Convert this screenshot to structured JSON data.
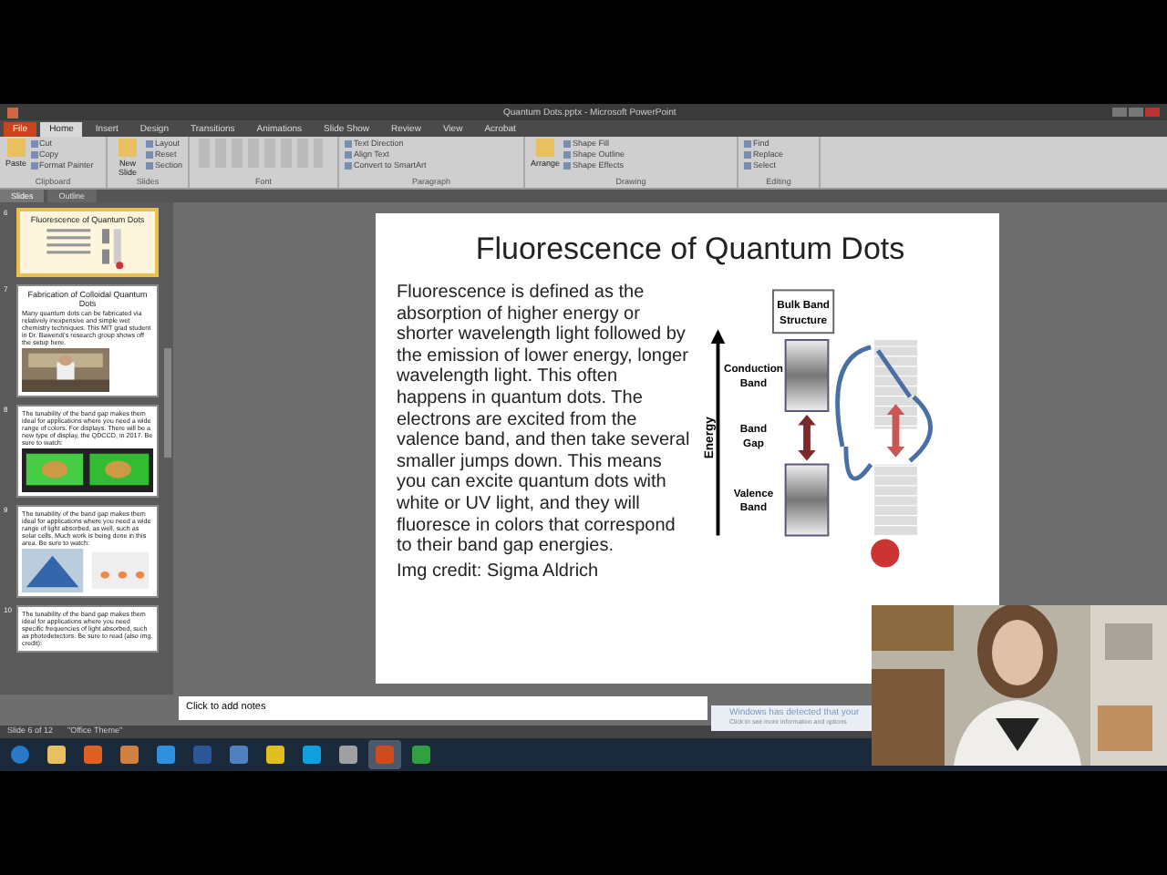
{
  "window": {
    "title": "Quantum Dots.pptx - Microsoft PowerPoint"
  },
  "ribbon_tabs": [
    {
      "label": "File",
      "selected": false,
      "kind": "file"
    },
    {
      "label": "Home",
      "selected": true,
      "kind": "tab"
    },
    {
      "label": "Insert",
      "selected": false,
      "kind": "tab"
    },
    {
      "label": "Design",
      "selected": false,
      "kind": "tab"
    },
    {
      "label": "Transitions",
      "selected": false,
      "kind": "tab"
    },
    {
      "label": "Animations",
      "selected": false,
      "kind": "tab"
    },
    {
      "label": "Slide Show",
      "selected": false,
      "kind": "tab"
    },
    {
      "label": "Review",
      "selected": false,
      "kind": "tab"
    },
    {
      "label": "View",
      "selected": false,
      "kind": "tab"
    },
    {
      "label": "Acrobat",
      "selected": false,
      "kind": "tab"
    }
  ],
  "ribbon_groups": [
    {
      "name": "Clipboard",
      "big": "Paste",
      "small": [
        "Cut",
        "Copy",
        "Format Painter"
      ]
    },
    {
      "name": "Slides",
      "big": "New Slide",
      "small": [
        "Layout",
        "Reset",
        "Section"
      ]
    },
    {
      "name": "Font"
    },
    {
      "name": "Paragraph",
      "small": [
        "Text Direction",
        "Align Text",
        "Convert to SmartArt"
      ]
    },
    {
      "name": "Drawing",
      "big": "Arrange",
      "small": [
        "Shape Fill",
        "Shape Outline",
        "Shape Effects"
      ]
    },
    {
      "name": "Editing",
      "small": [
        "Find",
        "Replace",
        "Select"
      ]
    }
  ],
  "panel_tabs": [
    {
      "label": "Slides",
      "selected": true
    },
    {
      "label": "Outline",
      "selected": false
    }
  ],
  "thumbnails": [
    {
      "number": "6",
      "selected": true,
      "title": "Fluorescence of Quantum Dots",
      "kind": "current"
    },
    {
      "number": "7",
      "selected": false,
      "title": "Fabrication of Colloidal Quantum Dots",
      "text": "Many quantum dots can be fabricated via relatively inexpensive and simple wet chemistry techniques. This MIT grad student in Dr. Bawendi's research group shows off the setup here."
    },
    {
      "number": "8",
      "selected": false,
      "text": "The tunability of the band gap makes them ideal for applications where you need a wide range of colors. For displays. There will be a new type of display, the QDCCD, in 2017. Be sure to watch:",
      "kind": "screens"
    },
    {
      "number": "9",
      "selected": false,
      "text": "The tunability of the band gap makes them ideal for applications where you need a wide range of light absorbed, as well, such as solar cells. Much work is being done in this area. Be sure to watch:",
      "kind": "diagram"
    },
    {
      "number": "10",
      "selected": false,
      "text": "The tunability of the band gap makes them ideal for applications where you need specific frequencies of light absorbed, such as photodetectors. Be sure to read (also img. credit):",
      "kind": "text"
    }
  ],
  "slide": {
    "title": "Fluorescence of Quantum Dots",
    "body": "Fluorescence is defined as the absorption of higher energy or shorter wavelength light followed by the emission of lower energy, longer wavelength light. This often happens in quantum dots. The electrons are excited from the valence band, and then take several smaller jumps down. This means you can excite quantum dots with white or UV light, and they will fluoresce in colors that correspond to their band gap energies.",
    "credit": "Img credit: Sigma Aldrich",
    "diagram": {
      "header": "Bulk Band Structure",
      "axis": "Energy",
      "conduction": "Conduction Band",
      "gap": "Band Gap",
      "valence": "Valence Band"
    }
  },
  "notes": {
    "placeholder": "Click to add notes"
  },
  "status_bar": {
    "slide": "Slide 6 of 12",
    "theme": "\"Office Theme\""
  },
  "notification": {
    "title": "Windows has detected that your",
    "text": "Click to see more information and options"
  },
  "taskbar": {
    "apps": [
      {
        "kind": "start",
        "selected": false
      },
      {
        "kind": "folder",
        "selected": false
      },
      {
        "kind": "firefox",
        "selected": false
      },
      {
        "kind": "media",
        "selected": false
      },
      {
        "kind": "ie",
        "selected": false
      },
      {
        "kind": "word",
        "selected": false
      },
      {
        "kind": "cloud",
        "selected": false
      },
      {
        "kind": "chrome",
        "selected": false
      },
      {
        "kind": "skype",
        "selected": false
      },
      {
        "kind": "camera",
        "selected": false
      },
      {
        "kind": "powerpoint",
        "selected": true
      },
      {
        "kind": "app",
        "selected": false
      }
    ]
  }
}
